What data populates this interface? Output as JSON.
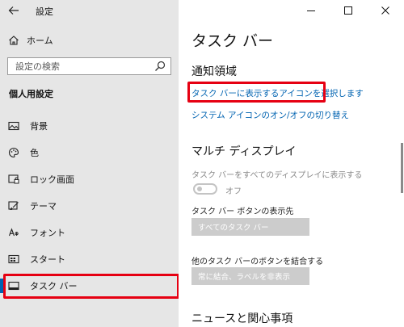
{
  "window": {
    "title": "設定",
    "controls": [
      "minimize",
      "maximize",
      "close"
    ]
  },
  "sidebar": {
    "home_label": "ホーム",
    "search_placeholder": "設定の検索",
    "section_heading": "個人用設定",
    "items": [
      {
        "label": "背景",
        "icon": "image-icon"
      },
      {
        "label": "色",
        "icon": "palette-icon"
      },
      {
        "label": "ロック画面",
        "icon": "lock-screen-icon"
      },
      {
        "label": "テーマ",
        "icon": "brush-icon"
      },
      {
        "label": "フォント",
        "icon": "font-icon"
      },
      {
        "label": "スタート",
        "icon": "start-icon"
      },
      {
        "label": "タスク バー",
        "icon": "taskbar-icon",
        "selected": true
      }
    ]
  },
  "main": {
    "page_title": "タスク バー",
    "notification_area": {
      "title": "通知領域",
      "link_select_icons": "タスク バーに表示するアイコンを選択します",
      "link_system_icons": "システム アイコンのオン/オフの切り替え"
    },
    "multi_display": {
      "title": "マルチ ディスプレイ",
      "show_all_label": "タスク バーをすべてのディスプレイに表示する",
      "toggle_state": "オフ",
      "toggle_on": false,
      "buttons_on_label": "タスク バー ボタンの表示先",
      "buttons_on_value": "すべてのタスク バー",
      "combine_label": "他のタスク バーのボタンを結合する",
      "combine_value": "常に結合、ラベルを非表示"
    },
    "news_title": "ニュースと関心事項"
  },
  "colors": {
    "accent": "#0063b1",
    "highlight": "#e60012",
    "sidebar_bg": "#e6e6e6"
  }
}
